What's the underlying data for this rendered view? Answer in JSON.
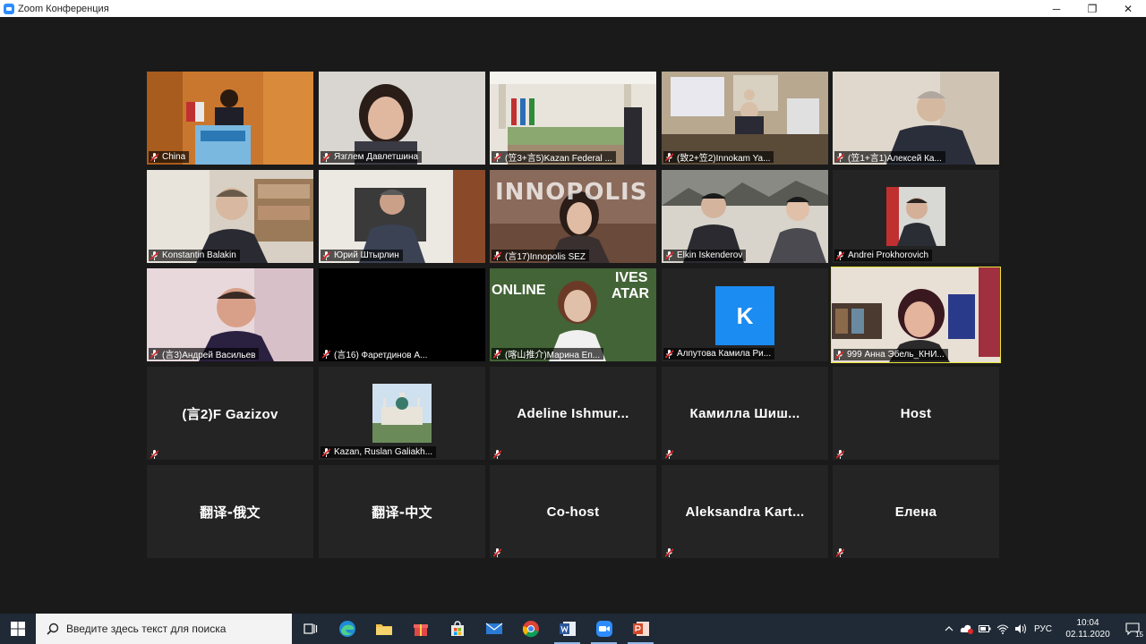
{
  "window": {
    "title": "Zoom Конференция",
    "controls": {
      "minimize": "─",
      "maximize": "❐",
      "close": "✕"
    }
  },
  "gallery": {
    "video_tiles": [
      {
        "name": "China"
      },
      {
        "name": "Язглем Давлетшина"
      },
      {
        "name": "(笠3+言5)Kazan Federal ..."
      },
      {
        "name": "(致2+笠2)Innokam Ya..."
      },
      {
        "name": "(笠1+言1)Алексей Ка..."
      },
      {
        "name": "Konstantin Balakin"
      },
      {
        "name": "Юрий Штырлин"
      },
      {
        "name": "(言17)Innopolis SEZ"
      },
      {
        "name": "Elkin Iskenderov"
      },
      {
        "name": "Andrei Prokhorovich"
      },
      {
        "name": "(言3)Андрей Васильев"
      },
      {
        "name": "(言16) Фаретдинов А..."
      },
      {
        "name": "(喀山推介)Марина Еп..."
      },
      {
        "name": "Алпутова Камила Ри..."
      },
      {
        "name": "999 Анна Эбель_КНИ..."
      }
    ],
    "avatar_letter": "K",
    "name_tiles": [
      {
        "name": "(言2)F Gazizov"
      },
      {
        "name": "Kazan, Ruslan Galiakh..."
      },
      {
        "name": "Adeline Ishmur..."
      },
      {
        "name": "Камилла Шиш..."
      },
      {
        "name": "Host"
      },
      {
        "name": "翻译-俄文"
      },
      {
        "name": "翻译-中文"
      },
      {
        "name": "Co-host"
      },
      {
        "name": "Aleksandra Kart..."
      },
      {
        "name": "Елена"
      }
    ],
    "video_text": {
      "innopolis": "INNOPOLIS",
      "online": "ONLINE",
      "ives": "IVES",
      "atar": "ATAR"
    }
  },
  "taskbar": {
    "search_placeholder": "Введите здесь текст для поиска",
    "apps": [
      "task-view",
      "edge",
      "file-explorer",
      "gift",
      "store",
      "mail",
      "chrome",
      "word",
      "zoom",
      "powerpoint"
    ],
    "tray": {
      "language": "РУС",
      "time": "10:04",
      "date": "02.11.2020",
      "notifications": "15"
    }
  },
  "colors": {
    "meeting_bg": "#1a1a1a",
    "tile_bg": "#242424",
    "active_speaker": "#e8e33a",
    "mute_red": "#e02828",
    "avatar_blue": "#1b8cf2",
    "taskbar": "#1f2a36"
  }
}
